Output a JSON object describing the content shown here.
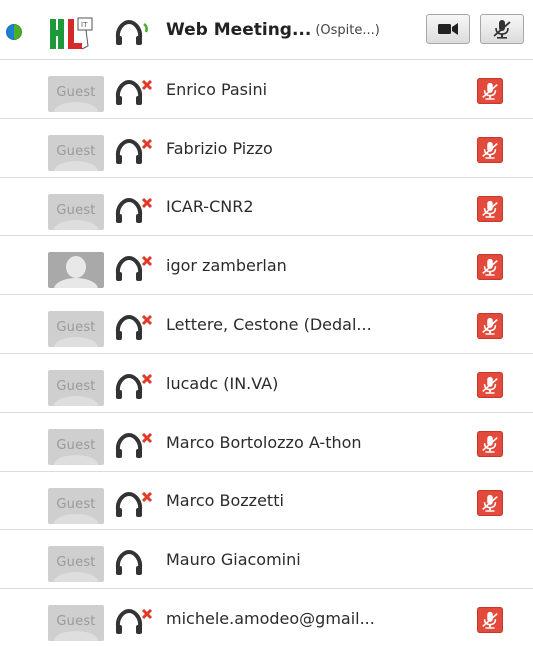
{
  "header": {
    "title": "Web Meeting...",
    "role": "(Ospite...)",
    "video_icon": "video-camera-icon",
    "mic_icon": "microphone-muted-icon"
  },
  "participants": [
    {
      "name": "Enrico Pasini",
      "avatar": "Guest",
      "muted": true
    },
    {
      "name": "Fabrizio Pizzo",
      "avatar": "Guest",
      "muted": true
    },
    {
      "name": "ICAR-CNR2",
      "avatar": "Guest",
      "muted": true
    },
    {
      "name": "igor zamberlan",
      "avatar": "photo",
      "muted": true
    },
    {
      "name": "Lettere, Cestone (Dedal...",
      "avatar": "Guest",
      "muted": true
    },
    {
      "name": "lucadc (IN.VA)",
      "avatar": "Guest",
      "muted": true
    },
    {
      "name": "Marco Bortolozzo A-thon",
      "avatar": "Guest",
      "muted": true
    },
    {
      "name": "Marco Bozzetti",
      "avatar": "Guest",
      "muted": true
    },
    {
      "name": "Mauro Giacomini",
      "avatar": "Guest",
      "muted": false
    },
    {
      "name": "michele.amodeo@gmail...",
      "avatar": "Guest",
      "muted": true
    }
  ],
  "colors": {
    "mute_red": "#e24a3b",
    "separator": "#dcdcdc",
    "headset_x": "#e23a2a",
    "headset_ok": "#4caf2a"
  }
}
